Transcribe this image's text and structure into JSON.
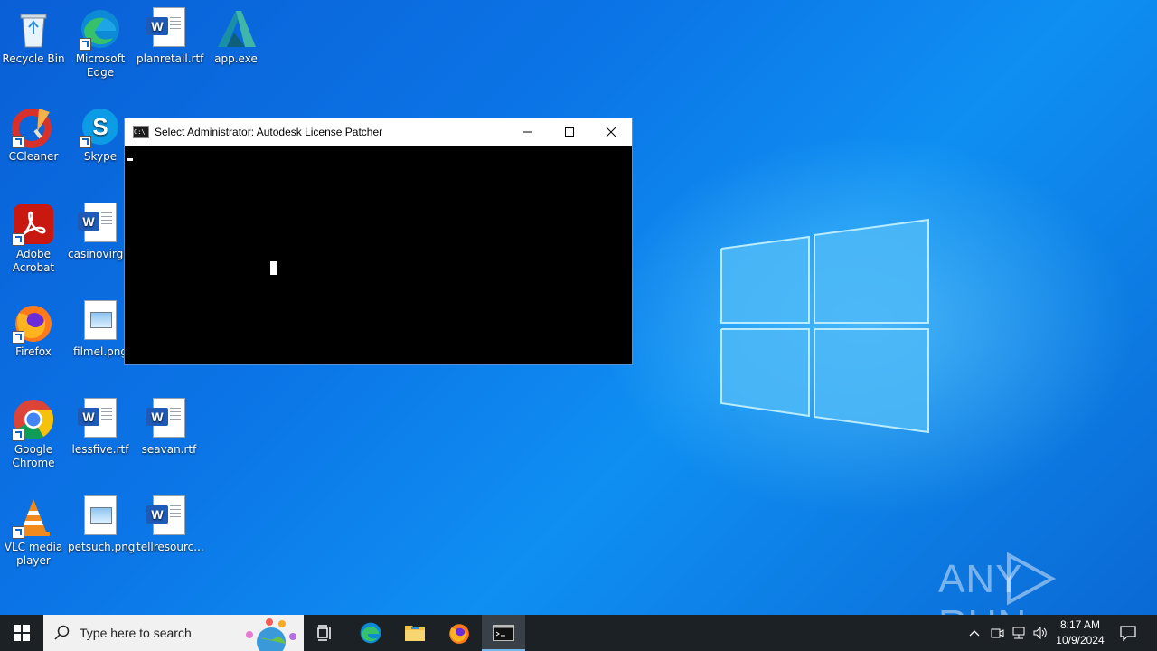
{
  "desktop": {
    "icons": [
      {
        "label": "Recycle Bin",
        "icon": "recycle-bin-icon"
      },
      {
        "label": "Microsoft Edge",
        "icon": "edge-icon"
      },
      {
        "label": "planretail.rtf",
        "icon": "word-document-icon"
      },
      {
        "label": "app.exe",
        "icon": "autodesk-icon"
      },
      {
        "label": "CCleaner",
        "icon": "ccleaner-icon"
      },
      {
        "label": "Skype",
        "icon": "skype-icon"
      },
      {
        "label": "Adobe Acrobat",
        "icon": "acrobat-icon"
      },
      {
        "label": "casinovirgi...",
        "icon": "word-document-icon"
      },
      {
        "label": "Firefox",
        "icon": "firefox-icon"
      },
      {
        "label": "filmel.png",
        "icon": "image-file-icon"
      },
      {
        "label": "Google Chrome",
        "icon": "chrome-icon"
      },
      {
        "label": "lessfive.rtf",
        "icon": "word-document-icon"
      },
      {
        "label": "seavan.rtf",
        "icon": "word-document-icon"
      },
      {
        "label": "VLC media player",
        "icon": "vlc-icon"
      },
      {
        "label": "petsuch.png",
        "icon": "image-file-icon"
      },
      {
        "label": "tellresourc...",
        "icon": "word-document-icon"
      }
    ]
  },
  "console": {
    "title": "Select Administrator:  Autodesk License Patcher",
    "icon": "cmd-icon",
    "controls": [
      "minimize-icon",
      "maximize-icon",
      "close-icon"
    ]
  },
  "watermark": {
    "text": "ANY RUN"
  },
  "taskbar": {
    "search_placeholder": "Type here to search",
    "apps": [
      "start-icon",
      "task-view-icon",
      "edge-icon",
      "file-explorer-icon",
      "firefox-icon",
      "cmd-icon"
    ],
    "time": "8:17 AM",
    "date": "10/9/2024",
    "tray": [
      "chevron-up-icon",
      "meet-now-icon",
      "network-icon",
      "volume-icon",
      "notification-icon"
    ]
  }
}
